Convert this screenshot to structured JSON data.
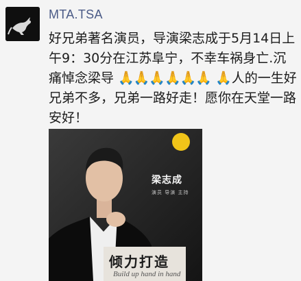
{
  "post": {
    "username": "MTA.TSA",
    "text": "好兄弟著名演员，导演梁志成于5月14日上午9：30分在江苏阜宁，不幸车祸身亡.沉痛悼念梁导",
    "emoji_run": "🙏🙏🙏🙏🙏🙏",
    "text2": "🙏人的一生好兄弟不多，兄弟一路好走！愿你在天堂一路安好！"
  },
  "image": {
    "name_title": "梁志成",
    "name_sub": "演员 导演 主持",
    "caption": "倾力打造",
    "caption_sub": "Build up hand in hand"
  },
  "colors": {
    "username": "#4a5a86",
    "background": "#f4f4f4",
    "avatar_bg": "#0f0f0f"
  },
  "icons": {
    "avatar": "kangaroo-logo-icon",
    "badge": "music-logo-icon"
  }
}
